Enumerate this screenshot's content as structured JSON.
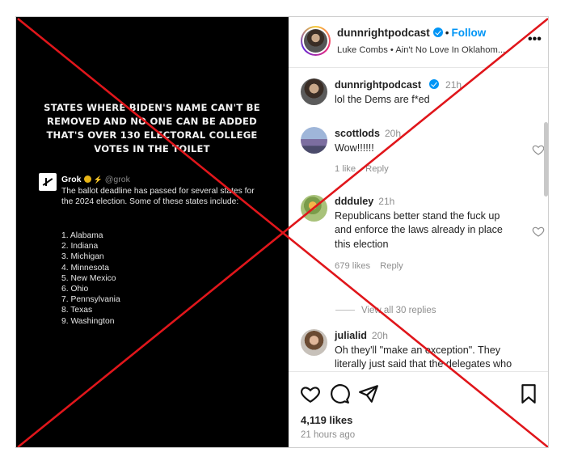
{
  "media": {
    "headline": "STATES WHERE BIDEN'S NAME CAN'T BE REMOVED AND NO ONE CAN BE ADDED THAT'S OVER 130 ELECTORAL COLLEGE VOTES IN THE TOILET",
    "grok_name": "Grok",
    "grok_handle": "@grok",
    "grok_text": "The ballot deadline has passed for several states for the 2024 election. Some of these states include:",
    "states": [
      "1. Alabama",
      "2. Indiana",
      "3. Michigan",
      "4. Minnesota",
      "5. New Mexico",
      "6. Ohio",
      "7. Pennsylvania",
      "8. Texas",
      "9. Washington"
    ]
  },
  "header": {
    "username": "dunnrightpodcast",
    "separator": "•",
    "follow_label": "Follow",
    "audio": "Luke Combs • Ain't No Love In Oklahom...",
    "more_icon": "more-horizontal-icon"
  },
  "comments": [
    {
      "user": "dunnrightpodcast",
      "time": "21h",
      "text": "lol the Dems are f*ed",
      "verified": true
    },
    {
      "user": "scottlods",
      "time": "20h",
      "text": "Wow!!!!!!",
      "likes": "1 like",
      "reply": "Reply"
    },
    {
      "user": "ddduley",
      "time": "21h",
      "text": "Republicans better stand the fuck up and enforce the laws already in place this election",
      "likes": "679 likes",
      "reply": "Reply"
    },
    {
      "user": "julialid",
      "time": "20h",
      "text": "Oh they'll \"make an exception\". They literally just said that the delegates who voted for him"
    }
  ],
  "view_replies": "View all 30 replies",
  "footer": {
    "likes": "4,119 likes",
    "time_ago": "21 hours ago"
  },
  "colors": {
    "accent": "#0095f6",
    "cross": "#e0161b",
    "media_bg": "#000000"
  }
}
